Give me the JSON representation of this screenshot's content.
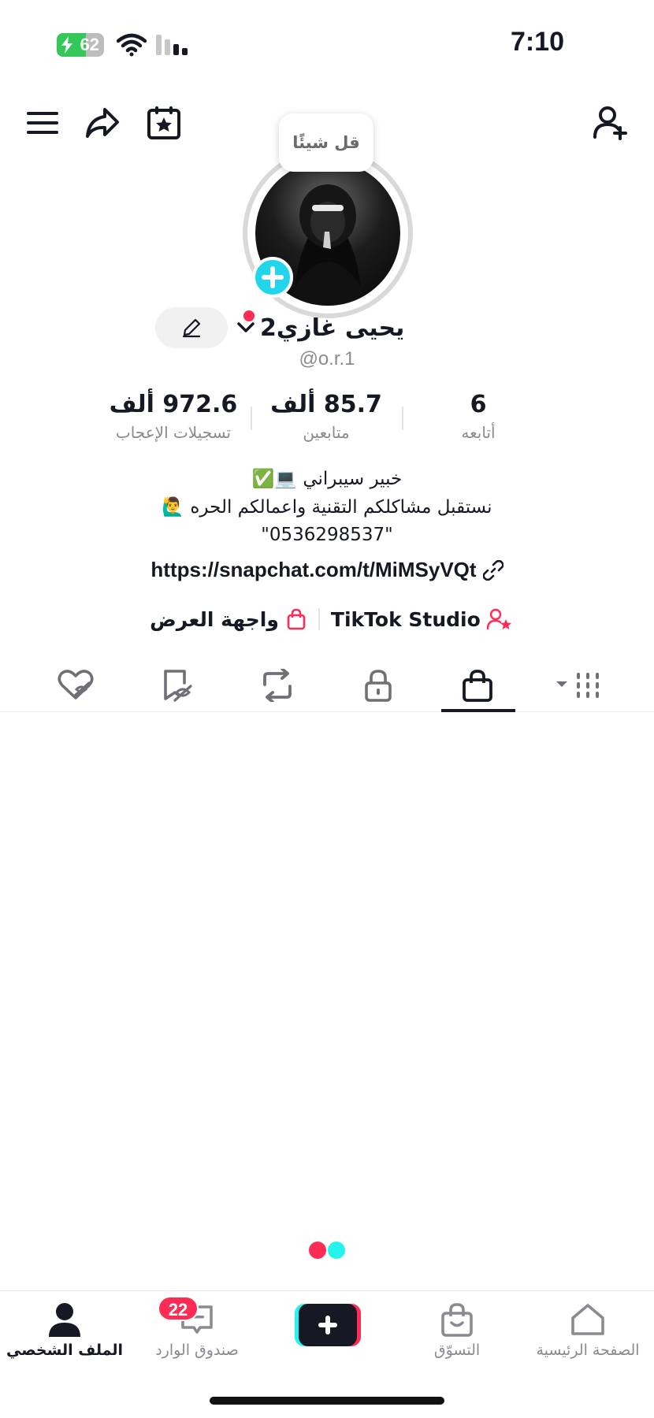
{
  "status_bar": {
    "time": "7:10",
    "battery_level": "62",
    "battery_fraction": 0.62
  },
  "colors": {
    "accent_red": "#fe2c55",
    "accent_cyan": "#25f4ee",
    "plus_blue": "#20d5ec"
  },
  "top_nav": {
    "icons": [
      "menu-icon",
      "share-icon",
      "calendar-star-icon",
      "add-friend-icon"
    ]
  },
  "profile": {
    "bubble_text": "قل شيئًا",
    "name": "يحيى غازي2",
    "handle": "@o.r.1",
    "stats": [
      {
        "value": "6",
        "label": "أتابعه"
      },
      {
        "value": "85.7 ألف",
        "label": "متابعين"
      },
      {
        "value": "972.6 ألف",
        "label": "تسجيلات الإعجاب"
      }
    ],
    "bio": [
      "خبير سيبراني 💻✅",
      "نستقبل مشاكلكم التقنية واعمالكم الحره 🙋‍♂️",
      "\"0536298537\""
    ],
    "link": "https://snapchat.com/t/MiMSyVQt",
    "chips": {
      "studio": "TikTok Studio",
      "showcase": "واجهة العرض"
    }
  },
  "tabs": [
    "grid-icon",
    "shopping-bag-icon",
    "lock-icon",
    "repost-icon",
    "favorites-icon",
    "liked-icon"
  ],
  "bottom_nav": {
    "home": "الصفحة الرئيسية",
    "shop": "التسوّق",
    "inbox": "صندوق الوارد",
    "inbox_badge": "22",
    "profile": "الملف الشخصي"
  }
}
